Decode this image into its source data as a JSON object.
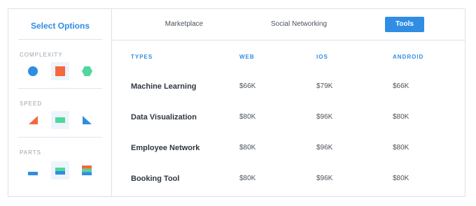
{
  "sidebar": {
    "title": "Select Options",
    "groups": [
      {
        "label": "COMPLEXITY",
        "options": [
          {
            "icon": "circle-icon",
            "color": "#2f8de4",
            "selected": false
          },
          {
            "icon": "square-icon",
            "color": "#f5673d",
            "selected": true
          },
          {
            "icon": "hexagon-icon",
            "color": "#4fd89a",
            "selected": false
          }
        ]
      },
      {
        "label": "SPEED",
        "options": [
          {
            "icon": "triangle-right-angle-icon",
            "color": "#f5673d",
            "selected": false
          },
          {
            "icon": "flat-bar-icon",
            "color": "#4fd89a",
            "selected": true
          },
          {
            "icon": "triangle-left-angle-icon",
            "color": "#2f8de4",
            "selected": false
          }
        ]
      },
      {
        "label": "PARTS",
        "options": [
          {
            "icon": "single-layer-icon",
            "color": "#2f8de4",
            "selected": false
          },
          {
            "icon": "two-layer-icon",
            "color": "#4fd89a",
            "selected": true
          },
          {
            "icon": "three-layer-icon",
            "color": "#f5673d",
            "selected": false
          }
        ]
      }
    ]
  },
  "tabs": [
    {
      "label": "Marketplace",
      "active": false
    },
    {
      "label": "Social Networking",
      "active": false
    },
    {
      "label": "Tools",
      "active": true
    }
  ],
  "table": {
    "headers": [
      "TYPES",
      "WEB",
      "IOS",
      "ANDROID"
    ],
    "rows": [
      {
        "name": "Machine Learning",
        "web": "$66K",
        "ios": "$79K",
        "android": "$66K"
      },
      {
        "name": "Data Visualization",
        "web": "$80K",
        "ios": "$96K",
        "android": "$80K"
      },
      {
        "name": "Employee Network",
        "web": "$80K",
        "ios": "$96K",
        "android": "$80K"
      },
      {
        "name": "Booking Tool",
        "web": "$80K",
        "ios": "$96K",
        "android": "$80K"
      }
    ]
  },
  "colors": {
    "accent": "#2f8de4",
    "orange": "#f5673d",
    "green": "#4fd89a"
  }
}
